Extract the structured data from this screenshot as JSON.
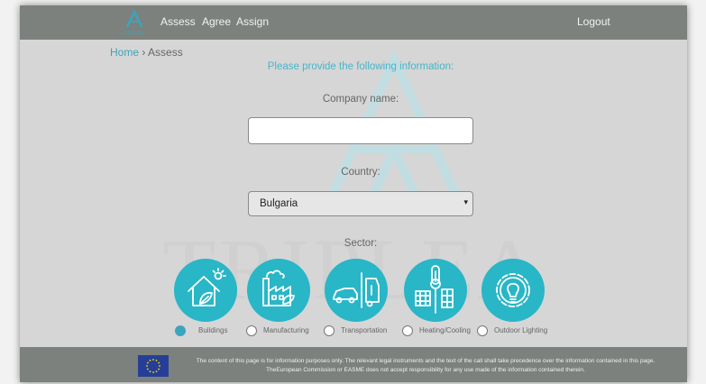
{
  "nav": {
    "logo_text": "TRIPLEA",
    "links": [
      "Assess",
      "Agree",
      "Assign"
    ],
    "logout": "Logout"
  },
  "watermark": {
    "text": "TRIPLEA"
  },
  "breadcrumb": {
    "home": "Home",
    "separator": "›",
    "current": "Assess"
  },
  "form": {
    "heading": "Please provide the following information:",
    "company_label": "Company name:",
    "company_value": "",
    "country_label": "Country:",
    "country_value": "Bulgaria",
    "sector_label": "Sector:",
    "sectors": [
      {
        "label": "Buildings",
        "icon": "house-leaf-icon",
        "selected": true
      },
      {
        "label": "Manufacturing",
        "icon": "factory-icon",
        "selected": false
      },
      {
        "label": "Transportation",
        "icon": "truck-icon",
        "selected": false
      },
      {
        "label": "Heating/Cooling",
        "icon": "thermometer-building-icon",
        "selected": false
      },
      {
        "label": "Outdoor Lighting",
        "icon": "gear-bulb-icon",
        "selected": false
      }
    ]
  },
  "footer": {
    "flag": "eu-flag-icon",
    "disclaimer": "The content of this page is for information purposes only. The relevant legal instruments and the text of the call shall take precedence over the information contained in this page. TheEuropean Commission or EASME does not accept responsibility for any use made of the information contained therein."
  },
  "colors": {
    "accent": "#29b6c7",
    "link": "#3aa5bd",
    "navbar": "#7c817d",
    "background": "#d6d6d6",
    "eu_blue": "#263f96",
    "eu_stars": "#ffdd00"
  }
}
